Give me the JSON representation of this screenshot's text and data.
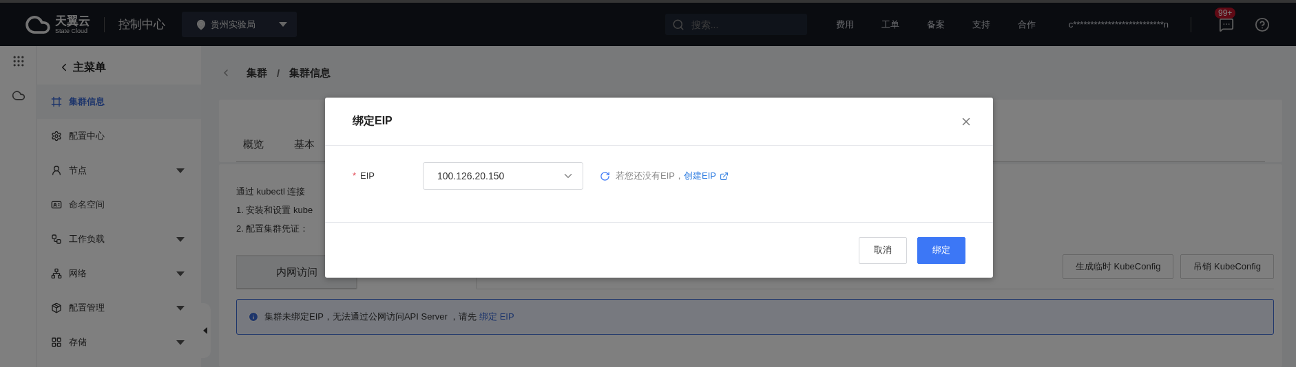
{
  "top_bar": {
    "logo": {
      "name": "天翼云",
      "sub": "State Cloud"
    },
    "title": "控制中心",
    "region": "贵州实验局",
    "search": {
      "placeholder": "搜索..."
    },
    "links": [
      "费用",
      "工单",
      "备案",
      "支持",
      "合作"
    ],
    "user": "c**************************n",
    "badge": "99+"
  },
  "sidebar": {
    "back": "主菜单",
    "items": [
      {
        "label": "集群信息",
        "kind": "link",
        "selected": true
      },
      {
        "label": "配置中心",
        "kind": "link",
        "selected": false
      },
      {
        "label": "节点",
        "kind": "group",
        "selected": false,
        "expanded": false
      },
      {
        "label": "命名空间",
        "kind": "link",
        "selected": false
      },
      {
        "label": "工作负载",
        "kind": "group",
        "selected": false,
        "expanded": false
      },
      {
        "label": "网络",
        "kind": "group",
        "selected": false,
        "expanded": false
      },
      {
        "label": "配置管理",
        "kind": "group",
        "selected": false,
        "expanded": false
      },
      {
        "label": "存储",
        "kind": "group",
        "selected": false,
        "expanded": false
      }
    ]
  },
  "breadcrumb": [
    "集群",
    "集群信息"
  ],
  "breadcrumb_separator": "/",
  "tabs": [
    {
      "label": "概览",
      "selected": false
    },
    {
      "label": "基本",
      "selected": false
    }
  ],
  "instructions": [
    "通过 kubectl 连接",
    "1. 安装和设置 kube",
    "2. 配置集群凭证："
  ],
  "access_tabs": [
    {
      "label": "内网访问",
      "selected": false
    },
    {
      "selected": true
    }
  ],
  "actions": [
    "生成临时 KubeConfig",
    "吊销 KubeConfig"
  ],
  "alert": {
    "text": "集群未绑定EIP，无法通过公网访问API Server ，请先",
    "link": "绑定 EIP"
  },
  "dialog": {
    "title": "绑定EIP",
    "field": {
      "label": "EIP",
      "required_mark": "*",
      "value": "100.126.20.150"
    },
    "hint": "若您还没有EIP，",
    "link": "创建EIP",
    "buttons": [
      {
        "label": "取消",
        "kind": "secondary"
      },
      {
        "label": "绑定",
        "kind": "primary"
      }
    ]
  }
}
